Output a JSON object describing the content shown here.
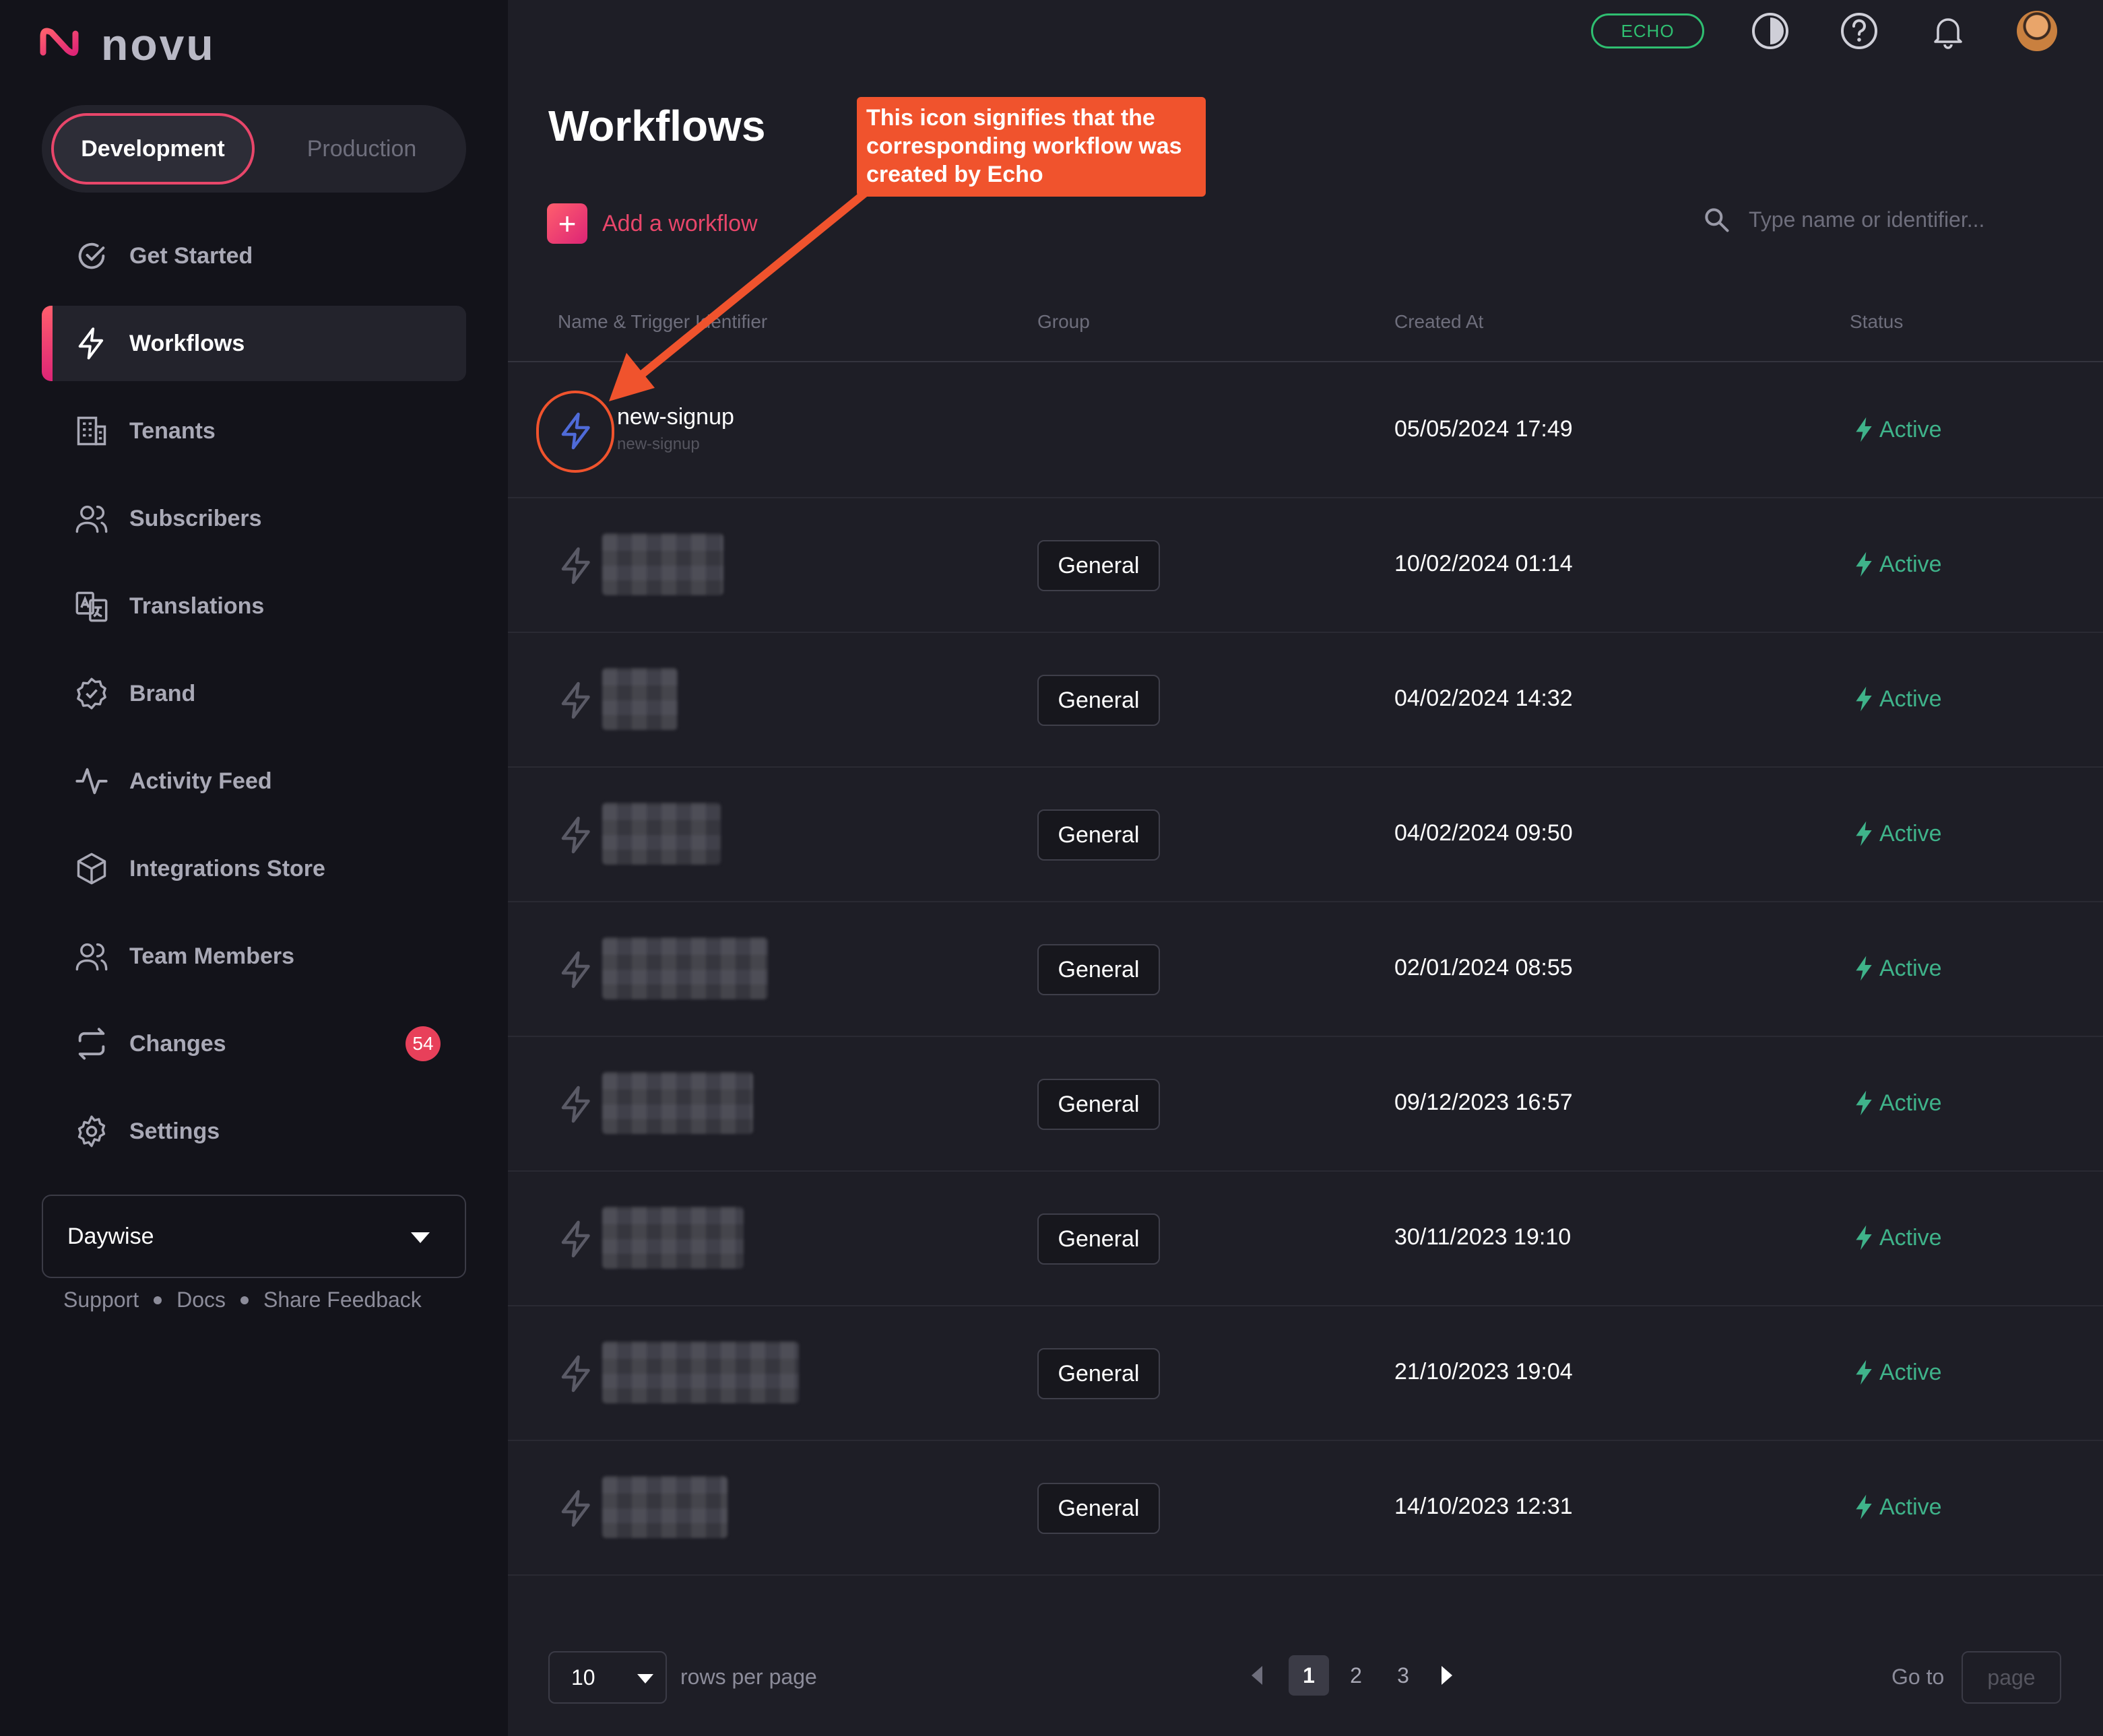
{
  "brand": {
    "name": "novu"
  },
  "environment": {
    "options": [
      "Development",
      "Production"
    ],
    "selected": "Development"
  },
  "sidebar": {
    "items": [
      {
        "label": "Get Started",
        "icon": "check-circle-icon"
      },
      {
        "label": "Workflows",
        "icon": "bolt-icon",
        "active": true
      },
      {
        "label": "Tenants",
        "icon": "building-icon"
      },
      {
        "label": "Subscribers",
        "icon": "users-icon"
      },
      {
        "label": "Translations",
        "icon": "translate-icon"
      },
      {
        "label": "Brand",
        "icon": "badge-check-icon"
      },
      {
        "label": "Activity Feed",
        "icon": "activity-icon"
      },
      {
        "label": "Integrations Store",
        "icon": "box-icon"
      },
      {
        "label": "Team Members",
        "icon": "users-icon"
      },
      {
        "label": "Changes",
        "icon": "swap-icon",
        "badge": "54"
      },
      {
        "label": "Settings",
        "icon": "gear-icon"
      }
    ],
    "organization": "Daywise",
    "footer_links": [
      "Support",
      "Docs",
      "Share Feedback"
    ]
  },
  "topbar": {
    "echo_label": "ECHO",
    "icons": [
      "theme-toggle-icon",
      "help-icon",
      "bell-icon",
      "avatar"
    ]
  },
  "main": {
    "title": "Workflows",
    "add_label": "Add a workflow",
    "search_placeholder": "Type name or identifier...",
    "columns": [
      "Name & Trigger Identifier",
      "Group",
      "Created At",
      "Status"
    ],
    "rows": [
      {
        "name": "new-signup",
        "identifier": "new-signup",
        "group": "",
        "created": "05/05/2024 17:49",
        "status": "Active",
        "echo": true
      },
      {
        "name": "",
        "identifier": "",
        "group": "General",
        "created": "10/02/2024 01:14",
        "status": "Active",
        "redacted": true
      },
      {
        "name": "",
        "identifier": "",
        "group": "General",
        "created": "04/02/2024 14:32",
        "status": "Active",
        "redacted": true
      },
      {
        "name": "",
        "identifier": "",
        "group": "General",
        "created": "04/02/2024 09:50",
        "status": "Active",
        "redacted": true
      },
      {
        "name": "",
        "identifier": "",
        "group": "General",
        "created": "02/01/2024 08:55",
        "status": "Active",
        "redacted": true
      },
      {
        "name": "",
        "identifier": "",
        "group": "General",
        "created": "09/12/2023 16:57",
        "status": "Active",
        "redacted": true
      },
      {
        "name": "",
        "identifier": "",
        "group": "General",
        "created": "30/11/2023 19:10",
        "status": "Active",
        "redacted": true
      },
      {
        "name": "",
        "identifier": "",
        "group": "General",
        "created": "21/10/2023 19:04",
        "status": "Active",
        "redacted": true
      },
      {
        "name": "",
        "identifier": "",
        "group": "General",
        "created": "14/10/2023 12:31",
        "status": "Active",
        "redacted": true
      }
    ],
    "annotation": "This icon signifies that the corresponding workflow was created by Echo"
  },
  "pagination": {
    "rows_per_page_value": "10",
    "rows_per_page_label": "rows per page",
    "pages": [
      "1",
      "2",
      "3"
    ],
    "current_page": "1",
    "goto_label": "Go to",
    "goto_placeholder": "page"
  },
  "colors": {
    "accent": "#e8466a",
    "echo": "#2fbf71",
    "active": "#3fb38a",
    "annotation": "#f0532d",
    "echo_icon": "#4f6bd8"
  }
}
